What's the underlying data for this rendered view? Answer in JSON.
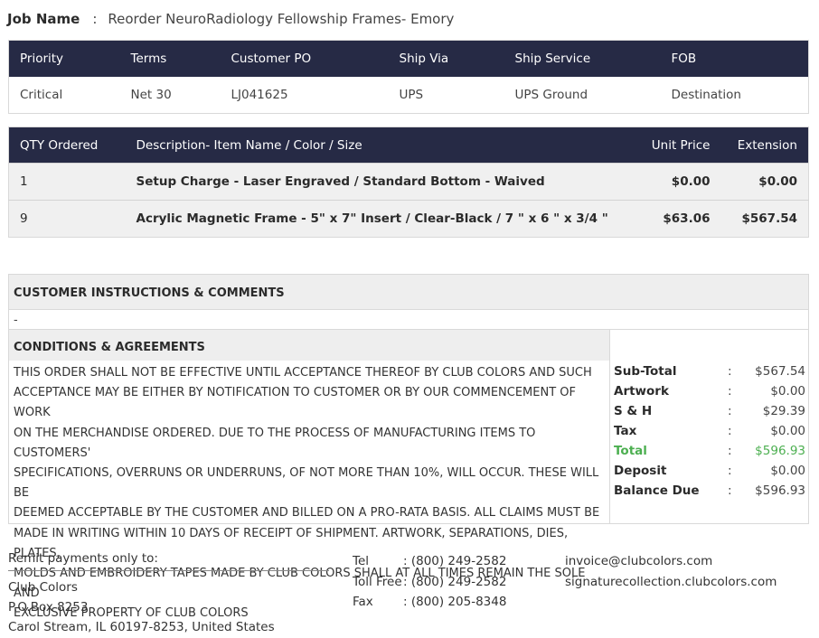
{
  "job": {
    "label": "Job Name",
    "separator": ":",
    "value": "Reorder NeuroRadiology Fellowship Frames- Emory"
  },
  "order_info": {
    "headers": [
      "Priority",
      "Terms",
      "Customer PO",
      "Ship Via",
      "Ship Service",
      "FOB"
    ],
    "values": [
      "Critical",
      "Net 30",
      "LJ041625",
      "UPS",
      "UPS Ground",
      "Destination"
    ]
  },
  "items": {
    "headers": [
      "QTY Ordered",
      "Description- Item Name / Color / Size",
      "Unit Price",
      "Extension"
    ],
    "rows": [
      {
        "qty": "1",
        "description": "Setup Charge - Laser Engraved / Standard Bottom - Waived",
        "unit_price": "$0.00",
        "extension": "$0.00"
      },
      {
        "qty": "9",
        "description": "Acrylic Magnetic Frame - 5\" x 7\" Insert / Clear-Black / 7 \" x 6 \" x 3/4 \"",
        "unit_price": "$63.06",
        "extension": "$567.54"
      }
    ]
  },
  "instructions": {
    "title": "CUSTOMER INSTRUCTIONS & COMMENTS",
    "body": "-"
  },
  "conditions": {
    "title": "CONDITIONS & AGREEMENTS",
    "lines": [
      "THIS ORDER SHALL NOT BE EFFECTIVE UNTIL ACCEPTANCE THEREOF BY CLUB COLORS AND SUCH",
      "ACCEPTANCE MAY BE EITHER BY NOTIFICATION TO CUSTOMER OR BY OUR COMMENCEMENT OF WORK",
      "ON THE MERCHANDISE ORDERED. DUE TO THE PROCESS OF MANUFACTURING ITEMS TO CUSTOMERS'",
      "SPECIFICATIONS, OVERRUNS OR UNDERRUNS, OF NOT MORE THAN 10%, WILL OCCUR. THESE WILL BE",
      "DEEMED ACCEPTABLE BY THE CUSTOMER AND BILLED ON A PRO-RATA BASIS. ALL CLAIMS MUST BE",
      "MADE IN WRITING WITHIN 10 DAYS OF RECEIPT OF SHIPMENT. ARTWORK, SEPARATIONS, DIES, PLATES,",
      "MOLDS AND EMBROIDERY TAPES MADE BY CLUB COLORS SHALL AT ALL TIMES REMAIN THE SOLE AND",
      "EXCLUSIVE PROPERTY OF CLUB COLORS"
    ]
  },
  "totals": [
    {
      "label": "Sub-Total",
      "sep": ":",
      "value": "$567.54"
    },
    {
      "label": "Artwork",
      "sep": ":",
      "value": "$0.00"
    },
    {
      "label": "S & H",
      "sep": ":",
      "value": "$29.39"
    },
    {
      "label": "Tax",
      "sep": ":",
      "value": "$0.00"
    },
    {
      "label": "Total",
      "sep": ":",
      "value": "$596.93"
    },
    {
      "label": "Deposit",
      "sep": ":",
      "value": "$0.00"
    },
    {
      "label": "Balance Due",
      "sep": ":",
      "value": "$596.93"
    }
  ],
  "remit": {
    "title": "Remit payments only to:",
    "lines": [
      "Club Colors",
      "P.O.Box 8253",
      "Carol Stream, IL 60197-8253, United States"
    ]
  },
  "contact": [
    {
      "label": "Tel",
      "value": ": (800) 249-2582"
    },
    {
      "label": "Toll Free",
      "value": ": (800) 249-2582"
    },
    {
      "label": "Fax",
      "value": ": (800) 205-8348"
    }
  ],
  "web": {
    "email": "invoice@clubcolors.com",
    "site": "signaturecollection.clubcolors.com"
  },
  "colors": {
    "header_bg": "#262a45",
    "total_green": "#4caf50"
  }
}
